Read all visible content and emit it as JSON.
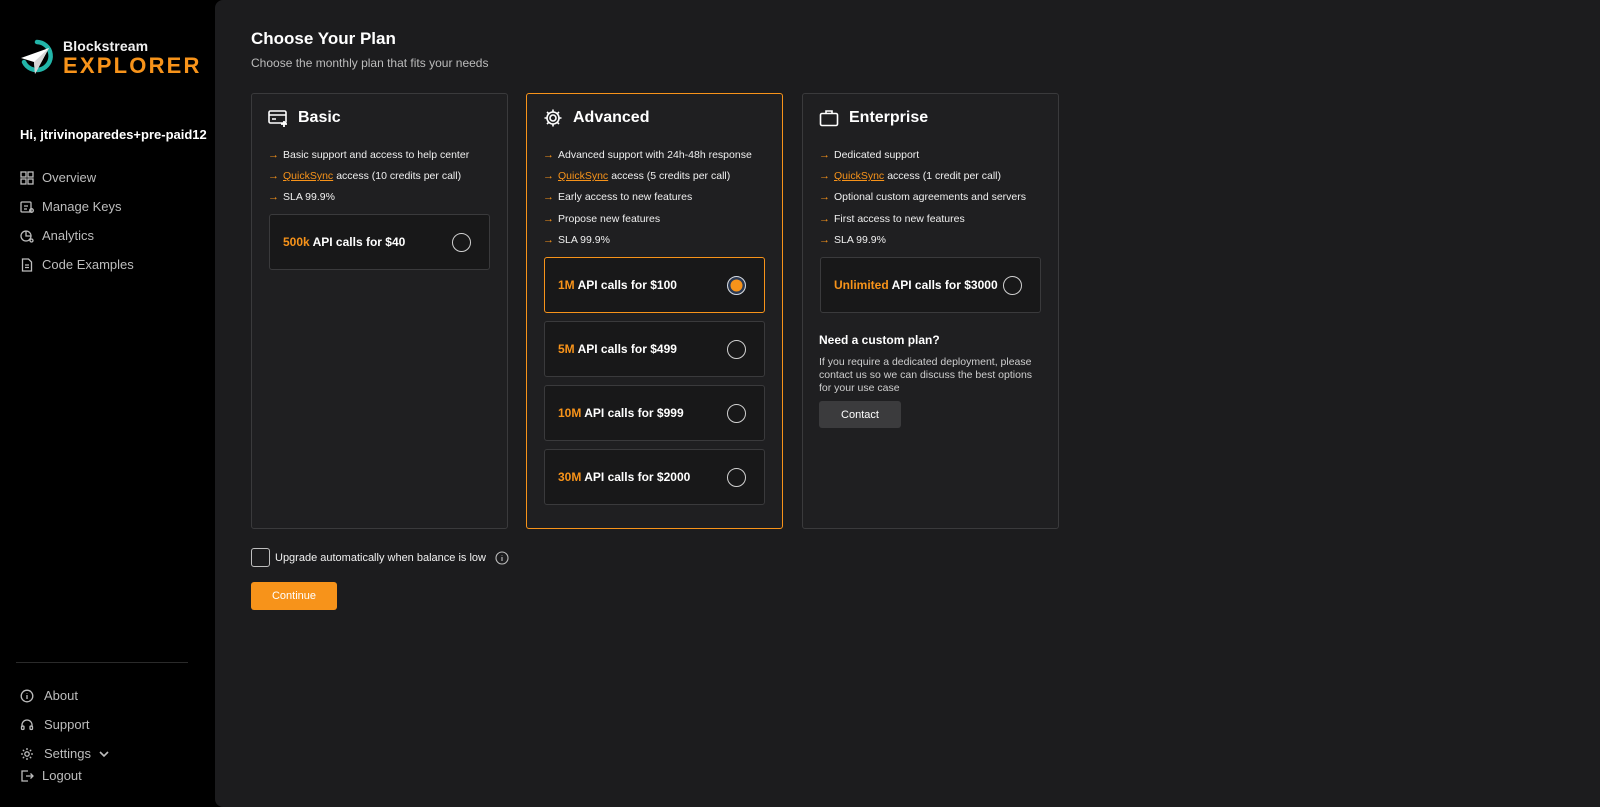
{
  "brand": {
    "top": "Blockstream",
    "bottom": "EXPLORER",
    "accent": "#f7931a"
  },
  "sidebar": {
    "greeting": "Hi, jtrivinoparedes+pre-paid12",
    "nav": [
      {
        "label": "Overview",
        "icon": "grid-icon"
      },
      {
        "label": "Manage Keys",
        "icon": "keys-icon"
      },
      {
        "label": "Analytics",
        "icon": "analytics-icon"
      },
      {
        "label": "Code Examples",
        "icon": "document-icon"
      }
    ],
    "bottom": [
      {
        "label": "About",
        "icon": "info-icon"
      },
      {
        "label": "Support",
        "icon": "headset-icon"
      },
      {
        "label": "Settings",
        "icon": "gear-icon"
      }
    ],
    "logout": "Logout"
  },
  "page": {
    "title": "Choose Your Plan",
    "subtitle": "Choose the monthly plan that fits your needs"
  },
  "plans": [
    {
      "name": "Basic",
      "icon": "card-plus-icon",
      "selected": false,
      "features": [
        {
          "text": "Basic support and access to help center"
        },
        {
          "link": "QuickSync",
          "text": "access (10 credits per call)"
        },
        {
          "text": "SLA 99.9%"
        }
      ],
      "options": [
        {
          "amount": "500k",
          "label": "API calls for $40",
          "selected": false
        }
      ]
    },
    {
      "name": "Advanced",
      "icon": "gear-icon",
      "selected": true,
      "features": [
        {
          "text": "Advanced support with 24h-48h response"
        },
        {
          "link": "QuickSync",
          "text": "access (5 credits per call)"
        },
        {
          "text": "Early access to new features"
        },
        {
          "text": "Propose new features"
        },
        {
          "text": "SLA 99.9%"
        }
      ],
      "options": [
        {
          "amount": "1M",
          "label": "API calls for $100",
          "selected": true
        },
        {
          "amount": "5M",
          "label": "API calls for $499",
          "selected": false
        },
        {
          "amount": "10M",
          "label": "API calls for $999",
          "selected": false
        },
        {
          "amount": "30M",
          "label": "API calls for $2000",
          "selected": false
        }
      ]
    },
    {
      "name": "Enterprise",
      "icon": "briefcase-icon",
      "selected": false,
      "features": [
        {
          "text": "Dedicated support"
        },
        {
          "link": "QuickSync",
          "text": "access (1 credit per call)"
        },
        {
          "text": "Optional custom agreements and servers"
        },
        {
          "text": "First access to new features"
        },
        {
          "text": "SLA 99.9%"
        }
      ],
      "options": [
        {
          "amount": "Unlimited",
          "label": "API calls for $3000",
          "selected": false
        }
      ],
      "custom": {
        "title": "Need a custom plan?",
        "text": "If you require a dedicated deployment, please contact us so we can discuss the best options for your use case",
        "button": "Contact"
      }
    }
  ],
  "auto_upgrade": {
    "label": "Upgrade automatically when balance is low",
    "checked": false
  },
  "continue_label": "Continue"
}
